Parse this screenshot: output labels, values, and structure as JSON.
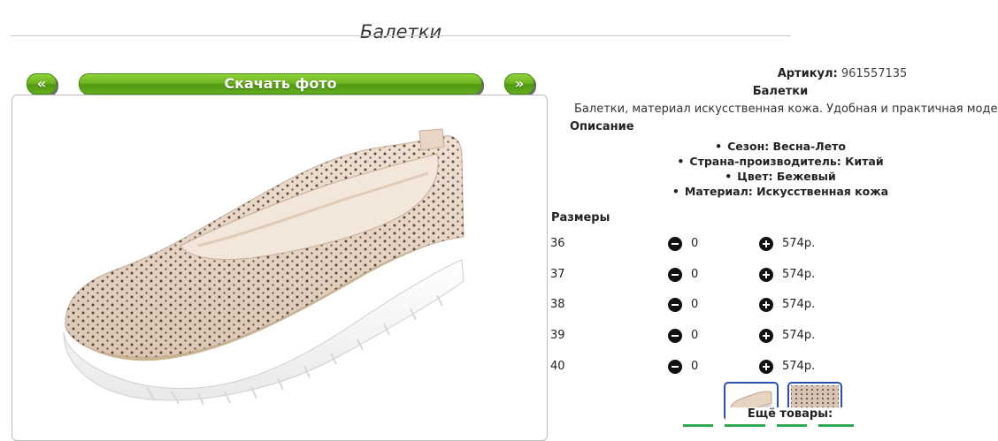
{
  "page": {
    "title": "Балетки"
  },
  "gallery": {
    "prev_label": "«",
    "download_label": "Скачать фото",
    "next_label": "»"
  },
  "product": {
    "article_label": "Артикул:",
    "article_value": "961557135",
    "name": "Балетки",
    "description": "Балетки, материал искусственная кожа. Удобная и практичная модель",
    "description_heading": "Описание",
    "properties": [
      "Сезон: Весна-Лето",
      "Страна-производитель: Китай",
      "Цвет: Бежевый",
      "Материал: Искусственная кожа"
    ],
    "sizes_heading": "Размеры",
    "sizes": [
      {
        "size": "36",
        "qty": "0",
        "price": "574р."
      },
      {
        "size": "37",
        "qty": "0",
        "price": "574р."
      },
      {
        "size": "38",
        "qty": "0",
        "price": "574р."
      },
      {
        "size": "39",
        "qty": "0",
        "price": "574р."
      },
      {
        "size": "40",
        "qty": "0",
        "price": "574р."
      }
    ]
  },
  "more": {
    "title": "Ещё товары:"
  },
  "colors": {
    "accent_green": "#6fb51f",
    "shoe_beige": "#e6d3c2",
    "thumb_border": "#2a4fb0"
  }
}
